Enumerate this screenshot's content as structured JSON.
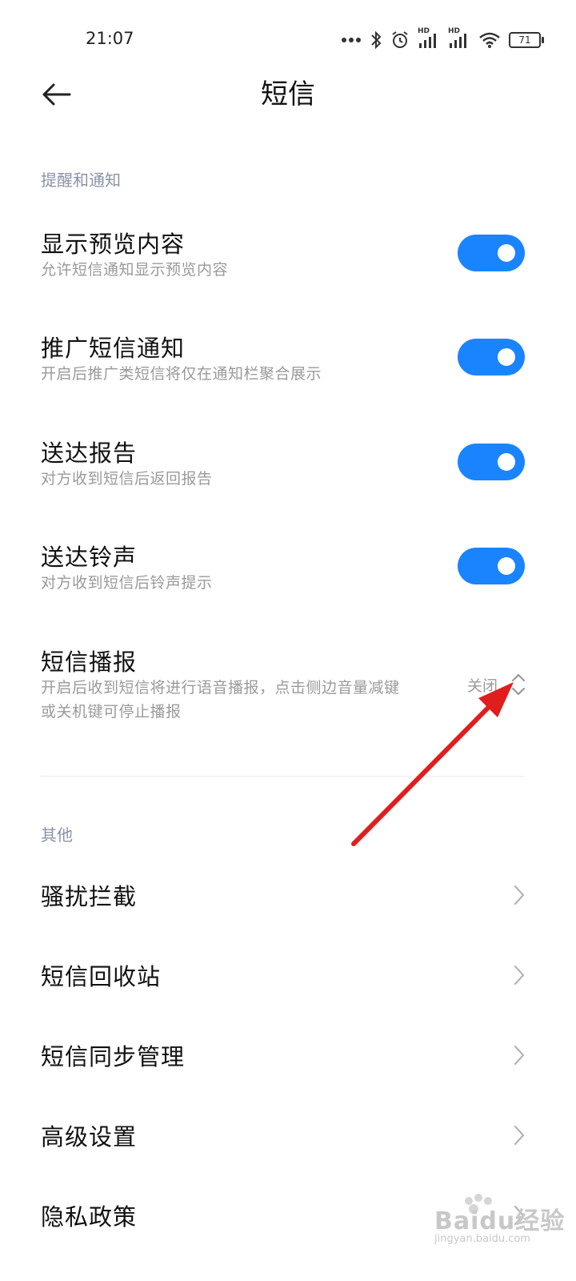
{
  "status": {
    "time": "21:07",
    "battery": "71",
    "hd1": "HD",
    "hd2": "HD"
  },
  "header": {
    "title": "短信"
  },
  "sections": {
    "reminders": "提醒和通知",
    "other": "其他"
  },
  "settings": [
    {
      "title": "显示预览内容",
      "subtitle": "允许短信通知显示预览内容",
      "enabled": true
    },
    {
      "title": "推广短信通知",
      "subtitle": "开启后推广类短信将仅在通知栏聚合展示",
      "enabled": true
    },
    {
      "title": "送达报告",
      "subtitle": "对方收到短信后返回报告",
      "enabled": true
    },
    {
      "title": "送达铃声",
      "subtitle": "对方收到短信后铃声提示",
      "enabled": true
    }
  ],
  "broadcast": {
    "title": "短信播报",
    "subtitle_line1": "开启后收到短信将进行语音播报，点击侧边音量减键",
    "subtitle_line2": "或关机键可停止播报",
    "value": "关闭"
  },
  "nav_items": [
    {
      "label": "骚扰拦截"
    },
    {
      "label": "短信回收站"
    },
    {
      "label": "短信同步管理"
    },
    {
      "label": "高级设置"
    },
    {
      "label": "隐私政策"
    }
  ],
  "watermark": {
    "text": "Baidu经验",
    "sub": "jingyan.baidu.com"
  },
  "colors": {
    "accent": "#1a84ff",
    "annotation_arrow": "#e01e1e"
  }
}
